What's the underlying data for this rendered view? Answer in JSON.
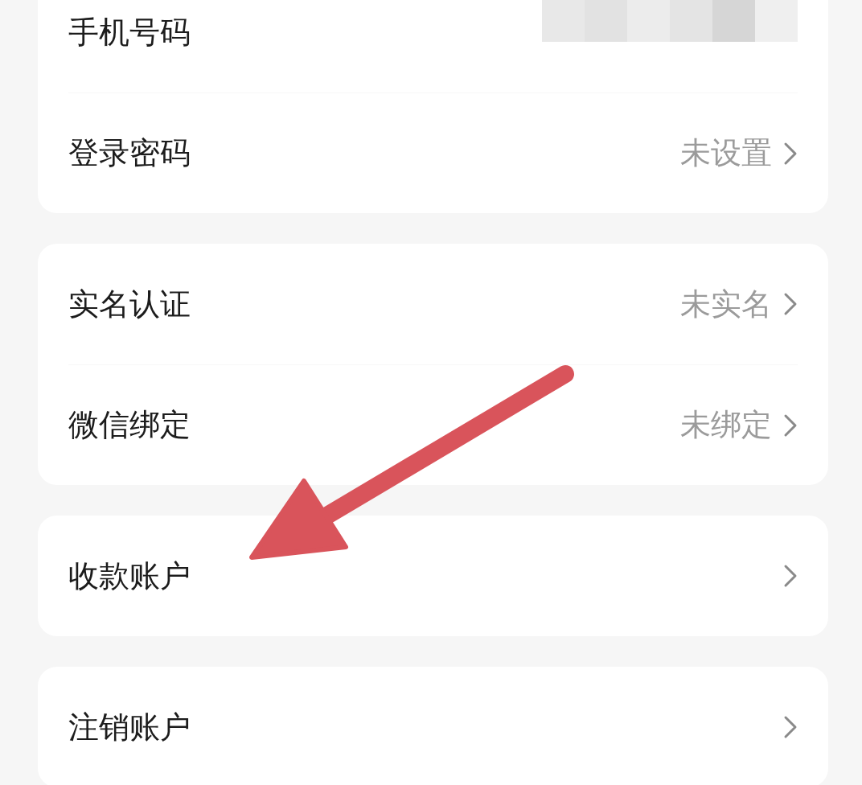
{
  "groups": [
    {
      "rows": [
        {
          "label": "手机号码",
          "kind": "masked"
        },
        {
          "label": "登录密码",
          "kind": "value",
          "value": "未设置"
        }
      ]
    },
    {
      "rows": [
        {
          "label": "实名认证",
          "kind": "value",
          "value": "未实名"
        },
        {
          "label": "微信绑定",
          "kind": "value",
          "value": "未绑定"
        }
      ]
    },
    {
      "rows": [
        {
          "label": "收款账户",
          "kind": "link"
        }
      ]
    },
    {
      "rows": [
        {
          "label": "注销账户",
          "kind": "link"
        }
      ]
    }
  ],
  "annotation": {
    "kind": "arrow",
    "color": "#d9545b"
  }
}
